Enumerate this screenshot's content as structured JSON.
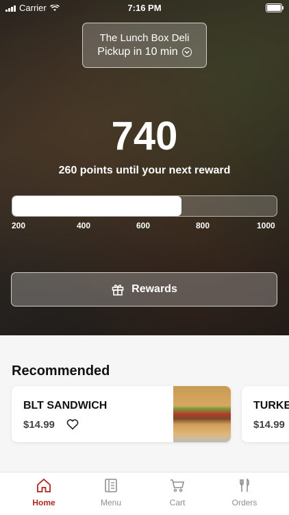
{
  "status_bar": {
    "carrier": "Carrier",
    "time": "7:16 PM"
  },
  "store": {
    "name": "The Lunch Box Deli",
    "pickup": "Pickup in 10 min"
  },
  "rewards": {
    "points": "740",
    "subtitle": "260 points until your next reward",
    "progress_fraction": 0.64,
    "ticks": [
      "200",
      "400",
      "600",
      "800",
      "1000"
    ],
    "button_label": "Rewards"
  },
  "recommended": {
    "title": "Recommended",
    "items": [
      {
        "name": "BLT SANDWICH",
        "price": "$14.99"
      },
      {
        "name": "TURKE",
        "price": "$14.99"
      }
    ]
  },
  "tabs": [
    {
      "label": "Home",
      "icon": "home-icon",
      "active": true
    },
    {
      "label": "Menu",
      "icon": "menu-icon",
      "active": false
    },
    {
      "label": "Cart",
      "icon": "cart-icon",
      "active": false
    },
    {
      "label": "Orders",
      "icon": "utensils-icon",
      "active": false
    }
  ],
  "colors": {
    "accent": "#b0251e"
  }
}
